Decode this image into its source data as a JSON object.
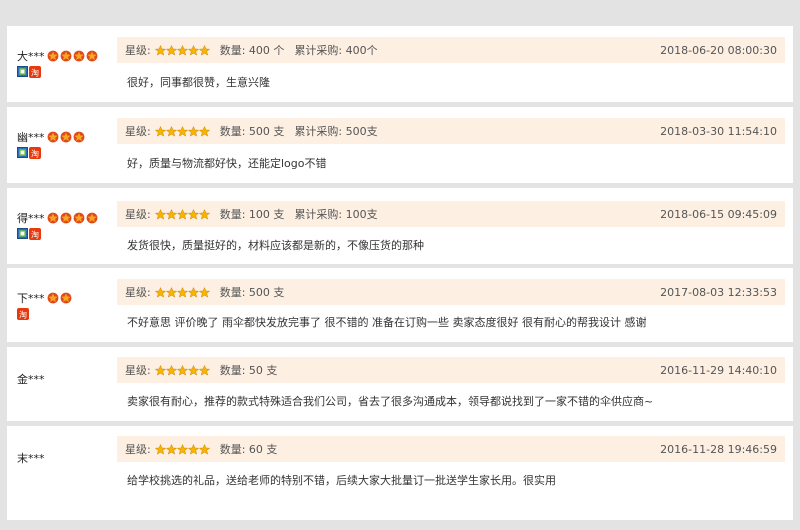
{
  "labels": {
    "rating": "星级:",
    "quantity": "数量:",
    "cumulative": "累计采购:"
  },
  "colors": {
    "page_bg": "#e3e3e3",
    "meta_bg": "#fdf0e3",
    "crown": "#f5a623",
    "star": "#f7b500",
    "taobao_badge": "#e8380d"
  },
  "reviews": [
    {
      "user": "大***",
      "crowns": 4,
      "badges": [
        "shield-badge",
        "taobao-badge"
      ],
      "stars": 5,
      "quantity": "400 个",
      "cumulative": "400个",
      "date": "2018-06-20 08:00:30",
      "content": "很好，同事都很赞，生意兴隆"
    },
    {
      "user": "幽***",
      "crowns": 3,
      "badges": [
        "shield-badge",
        "taobao-badge"
      ],
      "stars": 5,
      "quantity": "500 支",
      "cumulative": "500支",
      "date": "2018-03-30 11:54:10",
      "content": "好，质量与物流都好快，还能定logo不错"
    },
    {
      "user": "得***",
      "crowns": 4,
      "badges": [
        "shield-badge",
        "taobao-badge"
      ],
      "stars": 5,
      "quantity": "100 支",
      "cumulative": "100支",
      "date": "2018-06-15 09:45:09",
      "content": "发货很快，质量挺好的，材料应该都是新的，不像压货的那种"
    },
    {
      "user": "下***",
      "crowns": 2,
      "badges": [
        "taobao-badge"
      ],
      "stars": 5,
      "quantity": "500 支",
      "cumulative": "",
      "date": "2017-08-03 12:33:53",
      "content": "不好意思 评价晚了 雨伞都快发放完事了 很不错的 准备在订购一些 卖家态度很好 很有耐心的帮我设计 感谢"
    },
    {
      "user": "金***",
      "crowns": 0,
      "badges": [],
      "stars": 5,
      "quantity": "50 支",
      "cumulative": "",
      "date": "2016-11-29 14:40:10",
      "content": "卖家很有耐心，推荐的款式特殊适合我们公司，省去了很多沟通成本，领导都说找到了一家不错的伞供应商~"
    },
    {
      "user": "末***",
      "crowns": 0,
      "badges": [],
      "stars": 5,
      "quantity": "60 支",
      "cumulative": "",
      "date": "2016-11-28 19:46:59",
      "content": "给学校挑选的礼品，送给老师的特别不错，后续大家大批量订一批送学生家长用。很实用"
    }
  ]
}
